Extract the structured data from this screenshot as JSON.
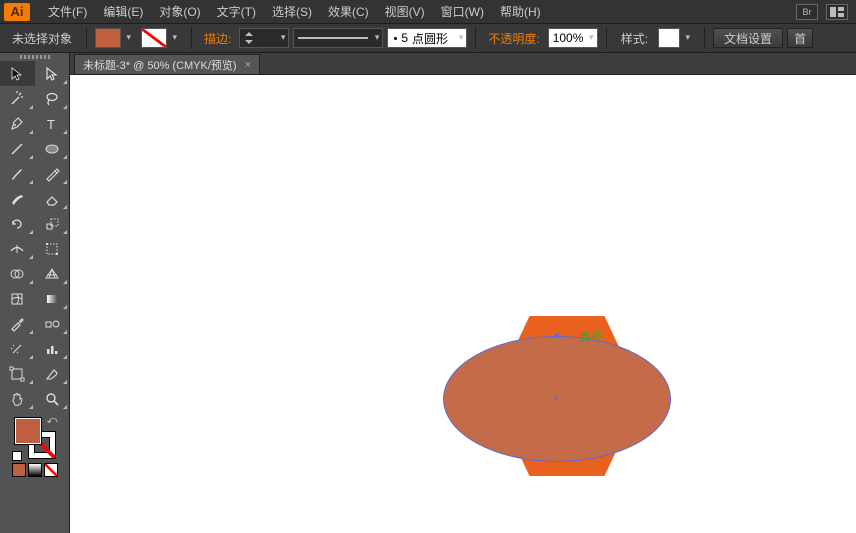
{
  "menu": {
    "items": [
      "文件(F)",
      "编辑(E)",
      "对象(O)",
      "文字(T)",
      "选择(S)",
      "效果(C)",
      "视图(V)",
      "窗口(W)",
      "帮助(H)"
    ],
    "logo": "Ai",
    "br": "Br"
  },
  "control": {
    "selection_state": "未选择对象",
    "stroke_label": "描边:",
    "stroke_pt_prefix": "5",
    "stroke_pt_suffix": "点圆形",
    "opacity_label": "不透明度:",
    "opacity_value": "100%",
    "style_label": "样式:",
    "doc_setup": "文档设置",
    "pref": "首"
  },
  "tab": {
    "title": "未标题-3* @ 50% (CMYK/预览)"
  },
  "canvas": {
    "path_label": "路径"
  },
  "colors": {
    "accent": "#f57c00",
    "fill": "#c06040",
    "hex_shape": "#e8611f",
    "ellipse_fill": "#c46b4a",
    "ellipse_stroke": "#5b6bd6",
    "path_label_color": "#2fa82f"
  }
}
